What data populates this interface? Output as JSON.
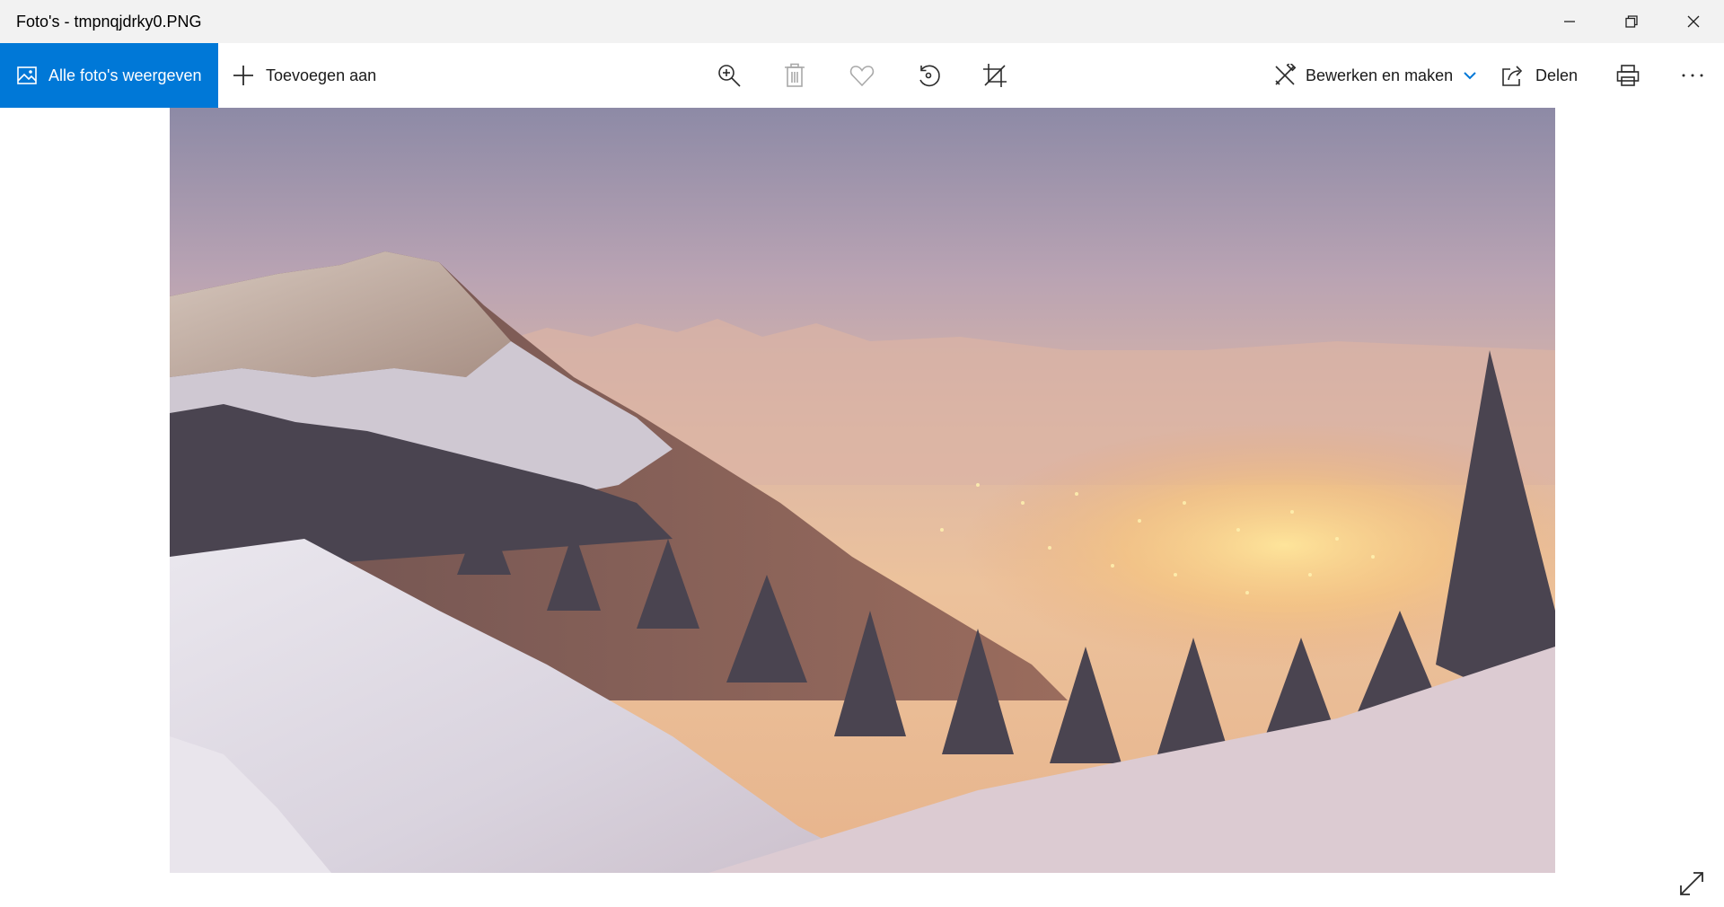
{
  "window": {
    "title": "Foto's - tmpnqjdrky0.PNG"
  },
  "toolbar": {
    "all_photos_label": "Alle foto's weergeven",
    "add_to_label": "Toevoegen aan",
    "edit_create_label": "Bewerken en maken",
    "share_label": "Delen",
    "icons": [
      "zoom-in-icon",
      "delete-icon",
      "heart-icon",
      "rotate-icon",
      "crop-icon",
      "print-icon",
      "more-icon"
    ],
    "delete_enabled": false
  },
  "colors": {
    "accent": "#0078d7",
    "titlebar": "#f2f2f2"
  }
}
